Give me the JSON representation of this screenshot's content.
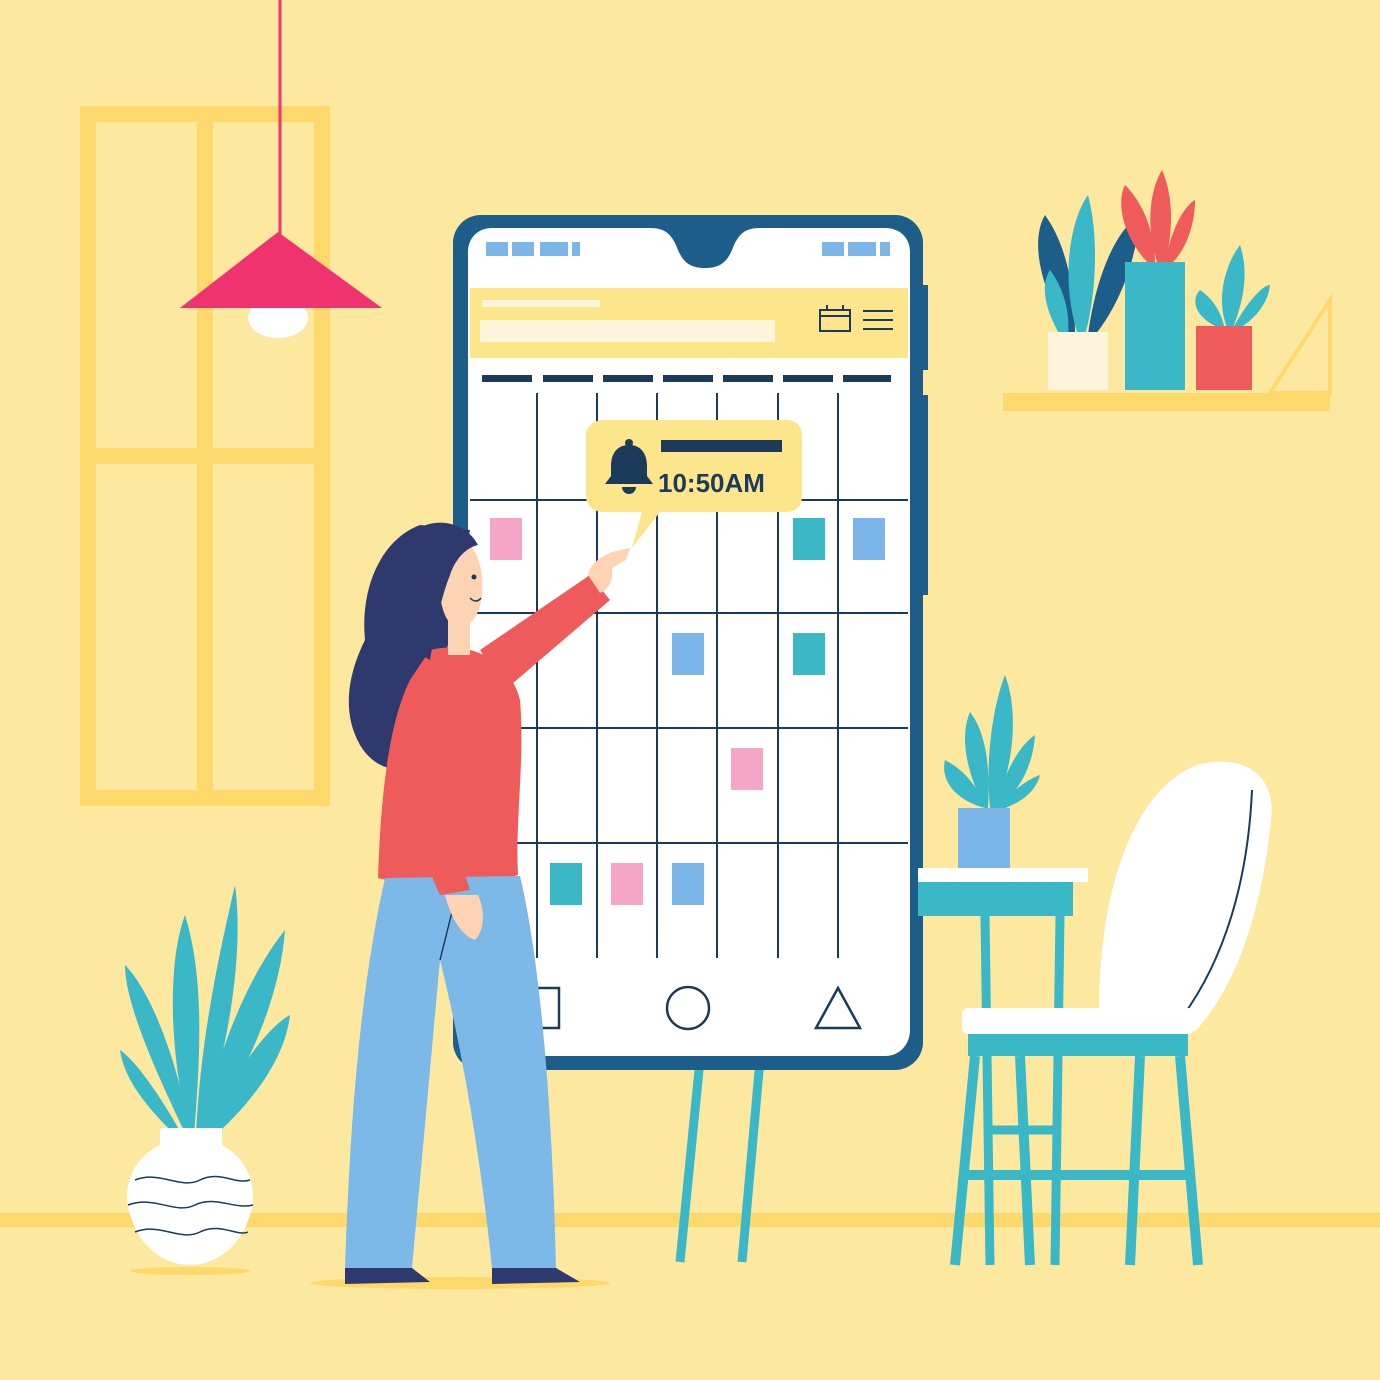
{
  "reminder": {
    "time": "10:50AM"
  },
  "palette": {
    "background": "#fde8a0",
    "frame_yellow": "#fcd96a",
    "phone_border": "#1c5d8a",
    "screen": "#ffffff",
    "header_bar": "#fde58c",
    "event_pink": "#f4a5c8",
    "event_teal": "#3ab8c8",
    "event_blue": "#7cb6e8",
    "lamp": "#f0336e",
    "shirt": "#ef5a5a",
    "hair": "#2e3a6e",
    "jeans": "#7cb9e8"
  },
  "icons": {
    "reminder": "bell-icon",
    "header_calendar": "calendar-icon",
    "header_menu": "menu-icon",
    "nav_back": "square-nav-icon",
    "nav_home": "circle-nav-icon",
    "nav_recent": "triangle-nav-icon"
  }
}
